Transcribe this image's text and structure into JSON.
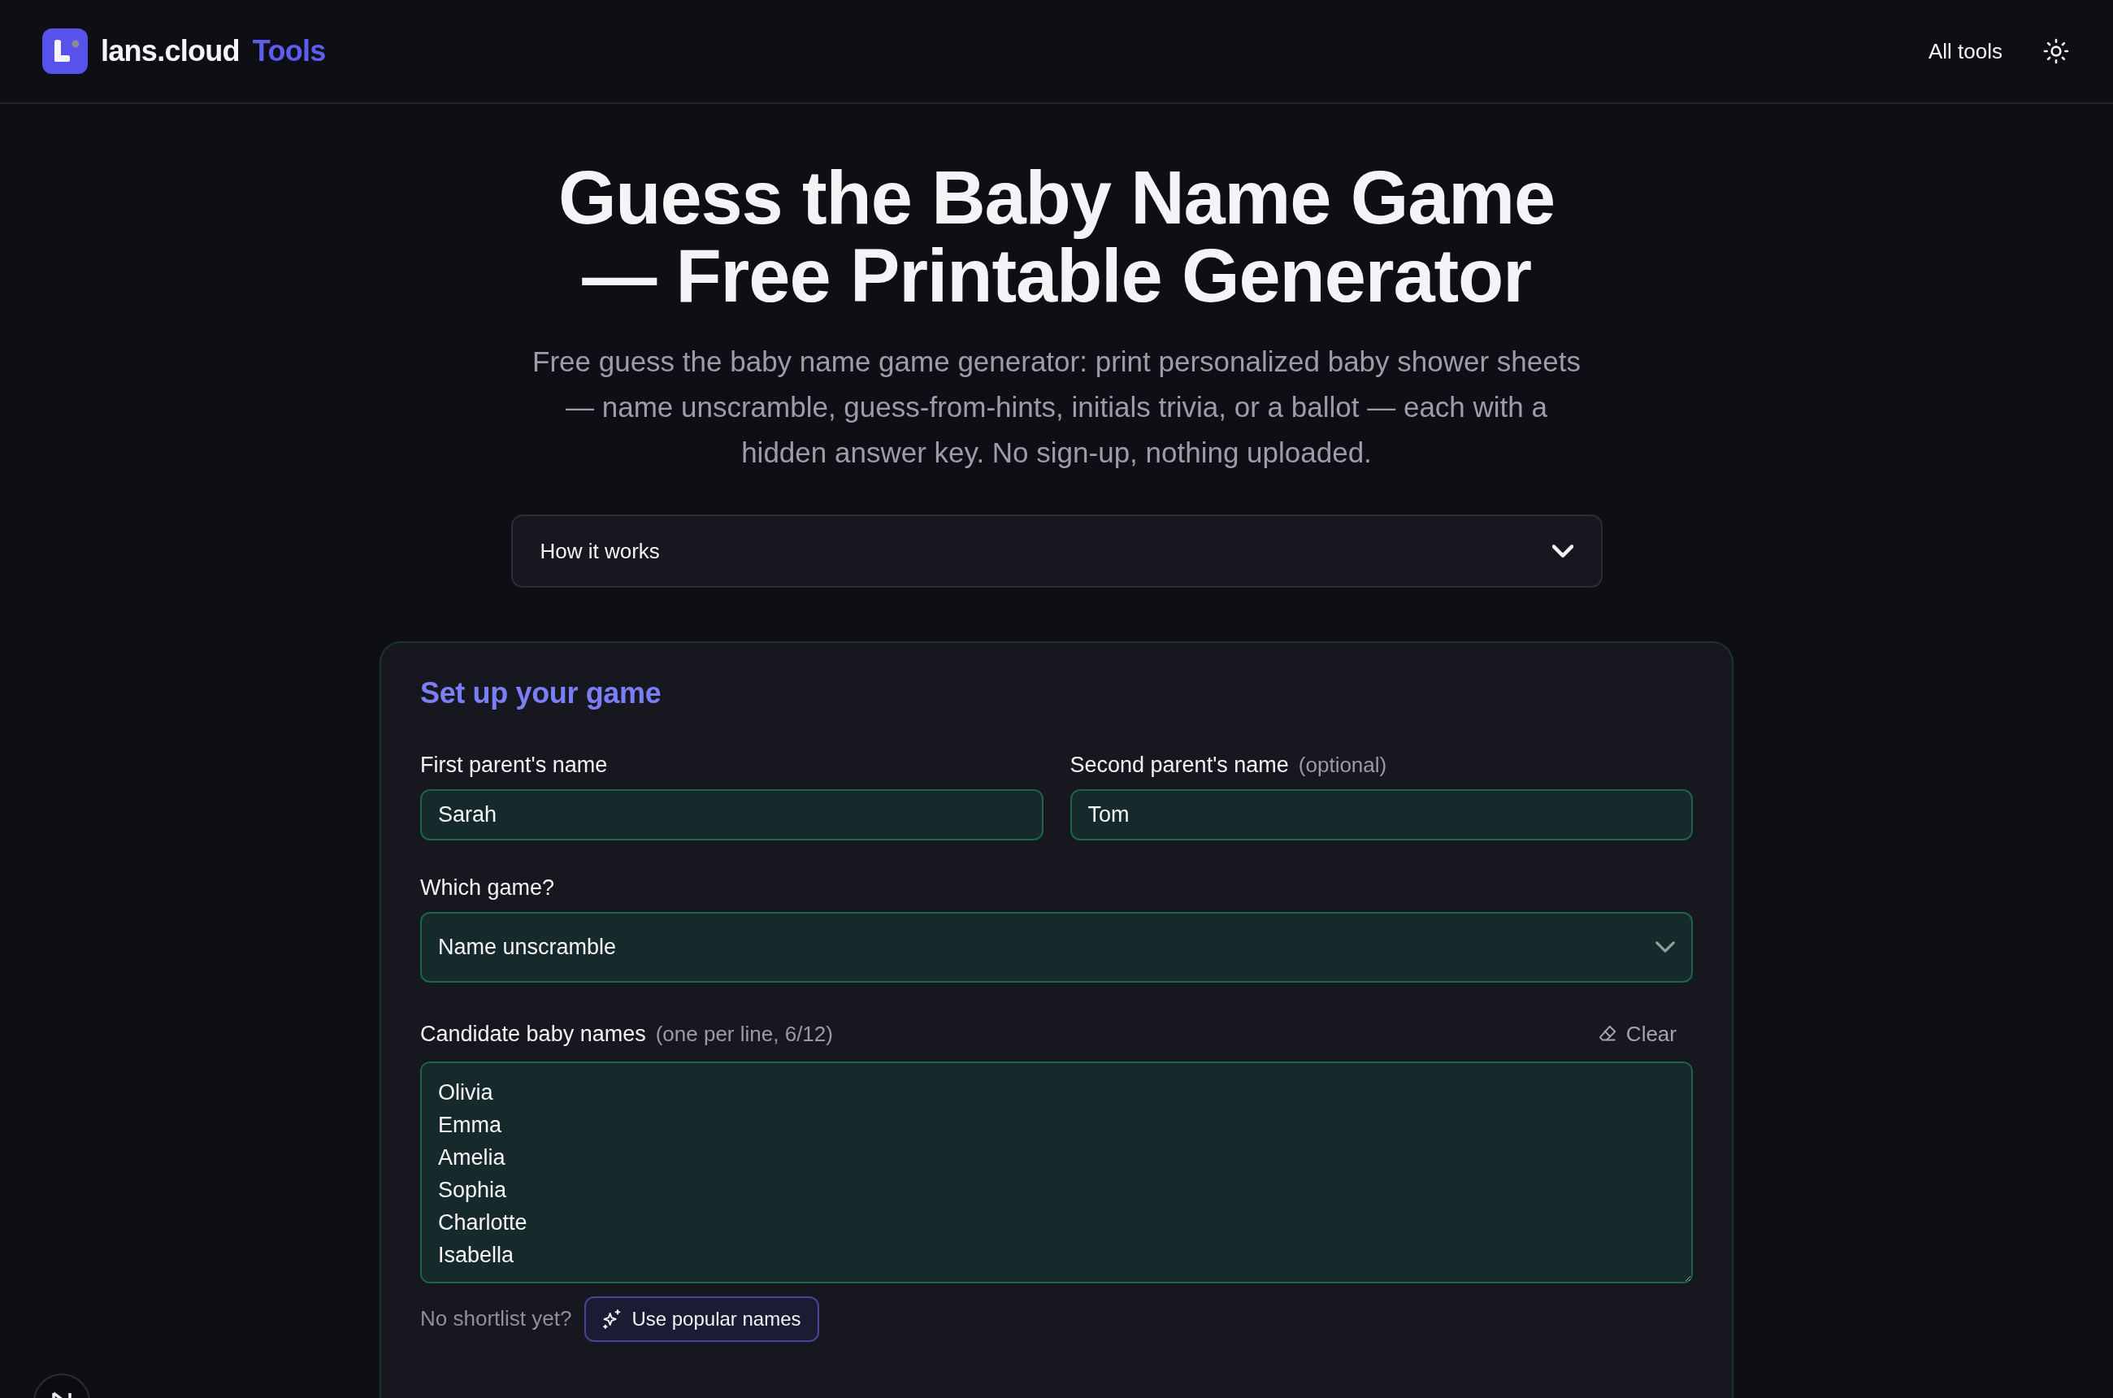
{
  "header": {
    "brand": {
      "name": "lans.cloud",
      "accent": "Tools"
    },
    "nav_link": "All tools"
  },
  "hero": {
    "title": "Guess the Baby Name Game — Free Printable Generator",
    "description": "Free guess the baby name game generator: print personalized baby shower sheets — name unscramble, guess-from-hints, initials trivia, or a ballot — each with a hidden answer key. No sign-up, nothing uploaded."
  },
  "how_it_works": {
    "label": "How it works",
    "expanded": false
  },
  "setup": {
    "title": "Set up your game",
    "parents": [
      {
        "label": "First parent's name",
        "value": "Sarah"
      },
      {
        "label": "Second parent's name",
        "hint": "(optional)",
        "value": "Tom"
      }
    ],
    "game": {
      "label": "Which game?",
      "value": "Name unscramble"
    },
    "names": {
      "label": "Candidate baby names",
      "hint": "(one per line, 6/12)",
      "clear_button": "Clear",
      "lines": [
        "Olivia",
        "Emma",
        "Amelia",
        "Sophia",
        "Charlotte",
        "Isabella"
      ]
    },
    "suggest": {
      "prompt": "No shortlist yet?",
      "button": "Use popular names"
    }
  }
}
